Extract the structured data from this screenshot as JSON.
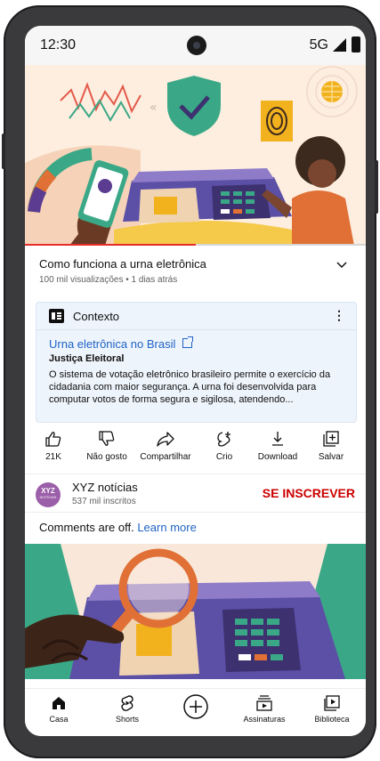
{
  "status_bar": {
    "time": "12:30",
    "network": "5G"
  },
  "player": {
    "progress_fraction": 0.5
  },
  "video": {
    "title": "Como funciona a urna eletrônica",
    "meta": "100 mil visualizações • 1 dias atrás"
  },
  "context_panel": {
    "heading": "Contexto",
    "link_text": "Urna eletrônica no Brasil",
    "source": "Justiça Eleitoral",
    "body": "O sistema de votação eletrônico brasileiro permite o exercício da cidadania com maior segurança. A urna foi desenvolvida para computar votos de forma segura e sigilosa, atendendo..."
  },
  "actions": [
    {
      "label": "21K",
      "icon": "thumbs-up-icon"
    },
    {
      "label": "Não gosto",
      "icon": "thumbs-down-icon"
    },
    {
      "label": "Compartilhar",
      "icon": "share-icon"
    },
    {
      "label": "Crio",
      "icon": "remix-icon"
    },
    {
      "label": "Download",
      "icon": "download-icon"
    },
    {
      "label": "Salvar",
      "icon": "save-icon"
    }
  ],
  "channel": {
    "avatar_text": "XYZ",
    "avatar_subtext": "NOTÍCIAS",
    "name": "XYZ notícias",
    "subscribers": "537 mil inscritos",
    "subscribe_label": "SE INSCREVER"
  },
  "comments": {
    "text": "Comments are off.",
    "link": "Learn more"
  },
  "bottom_nav": [
    {
      "label": "Casa",
      "icon": "home-icon"
    },
    {
      "label": "Shorts",
      "icon": "shorts-icon"
    },
    {
      "label": "",
      "icon": "create-icon"
    },
    {
      "label": "Assinaturas",
      "icon": "subscriptions-icon"
    },
    {
      "label": "Biblioteca",
      "icon": "library-icon"
    }
  ],
  "colors": {
    "accent_red": "#cc0000",
    "progress_red": "#e52d27",
    "link_blue": "#1f63c6",
    "context_bg": "#eef4fb"
  }
}
